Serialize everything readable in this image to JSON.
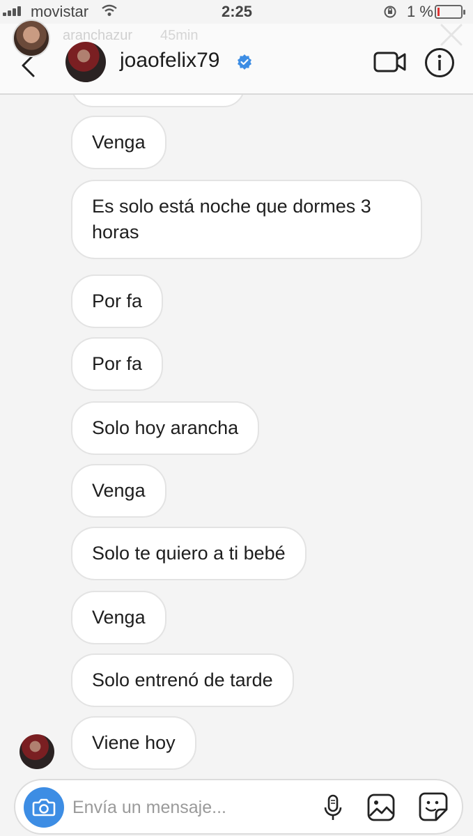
{
  "status_bar": {
    "carrier": "movistar",
    "time": "2:25",
    "battery": "1 %"
  },
  "story": {
    "username": "aranchazur",
    "time_ago": "45min"
  },
  "header": {
    "username": "joaofelix79",
    "icons": [
      "back-icon",
      "verified-badge-icon",
      "video-call-icon",
      "info-icon"
    ]
  },
  "messages": [
    "Venga",
    "Es solo está noche que dormes 3 horas",
    "Por fa",
    "Por fa",
    "Solo hoy arancha",
    "Venga",
    "Solo te quiero a ti bebé",
    "Venga",
    "Solo entrenó de tarde",
    "Viene hoy"
  ],
  "composer": {
    "placeholder": "Envía un mensaje...",
    "icons": [
      "camera-icon",
      "microphone-icon",
      "gallery-icon",
      "sticker-icon"
    ]
  },
  "colors": {
    "accent": "#3d8de4",
    "verified": "#3d8de4",
    "bubble_bg": "#ffffff",
    "bubble_border": "#e3e3e3"
  }
}
